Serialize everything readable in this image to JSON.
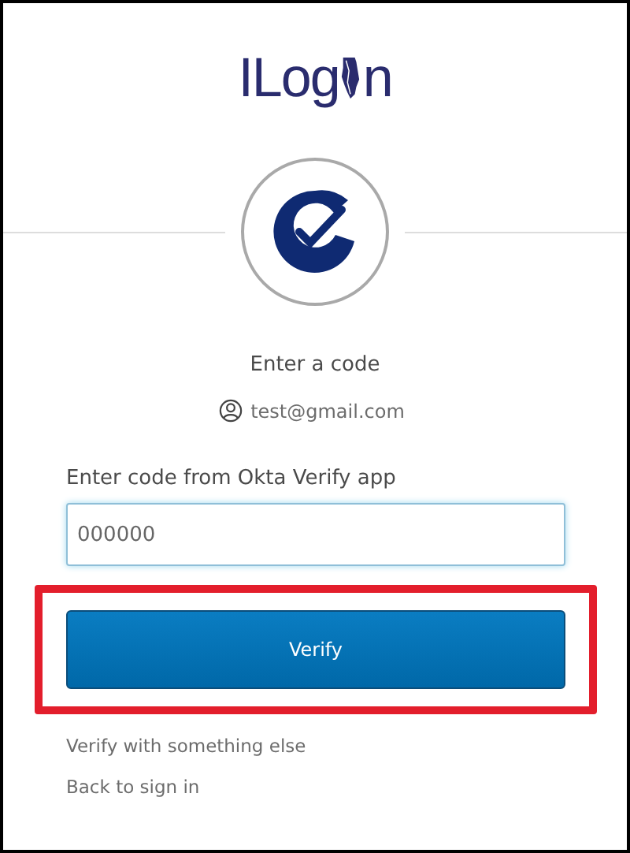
{
  "logo": {
    "before": "ILog",
    "after": "n"
  },
  "title": "Enter a code",
  "account": "test@gmail.com",
  "code_field": {
    "label": "Enter code from Okta Verify app",
    "value": "000000",
    "focused": true
  },
  "verify_button": {
    "label": "Verify",
    "highlighted": true
  },
  "links": [
    "Verify with something else",
    "Back to sign in"
  ]
}
